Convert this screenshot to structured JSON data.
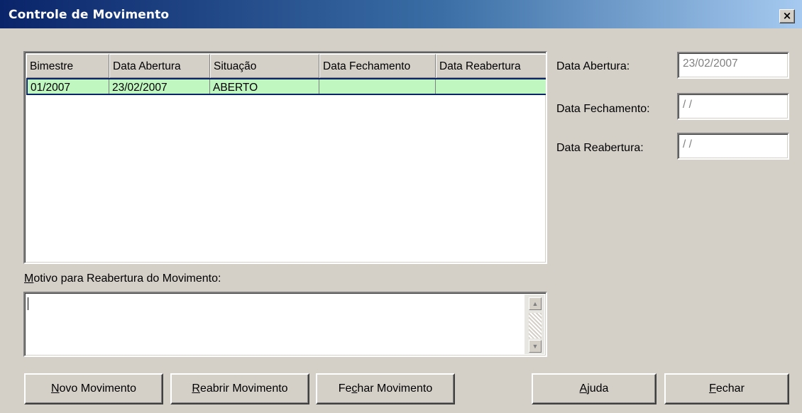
{
  "window": {
    "title": "Controle de Movimento",
    "close_glyph": "×"
  },
  "grid": {
    "columns": [
      "Bimestre",
      "Data Abertura",
      "Situação",
      "Data Fechamento",
      "Data Reabertura"
    ],
    "rows": [
      [
        "01/2007",
        "23/02/2007",
        "ABERTO",
        "",
        ""
      ]
    ],
    "selected_row_color": "#c0f6c0"
  },
  "fields": {
    "abertura": {
      "label": "Data Abertura:",
      "value": "23/02/2007"
    },
    "fechamento": {
      "label": "Data Fechamento:",
      "value": "/ /"
    },
    "reabertura": {
      "label": "Data Reabertura:",
      "value": "/ /"
    }
  },
  "motivo": {
    "label_accel": "M",
    "label_rest": "otivo para Reabertura do Movimento:",
    "value": ""
  },
  "buttons": {
    "novo": {
      "accel": "N",
      "rest": "ovo Movimento"
    },
    "reabrir": {
      "accel": "R",
      "rest": "eabrir Movimento"
    },
    "fechar_mov": {
      "pre": "Fe",
      "accel": "c",
      "rest": "har Movimento"
    },
    "ajuda": {
      "accel": "A",
      "rest": "juda"
    },
    "fechar": {
      "accel": "F",
      "rest": "echar"
    }
  },
  "icons": {
    "scroll_up": "▲",
    "scroll_down": "▼"
  }
}
